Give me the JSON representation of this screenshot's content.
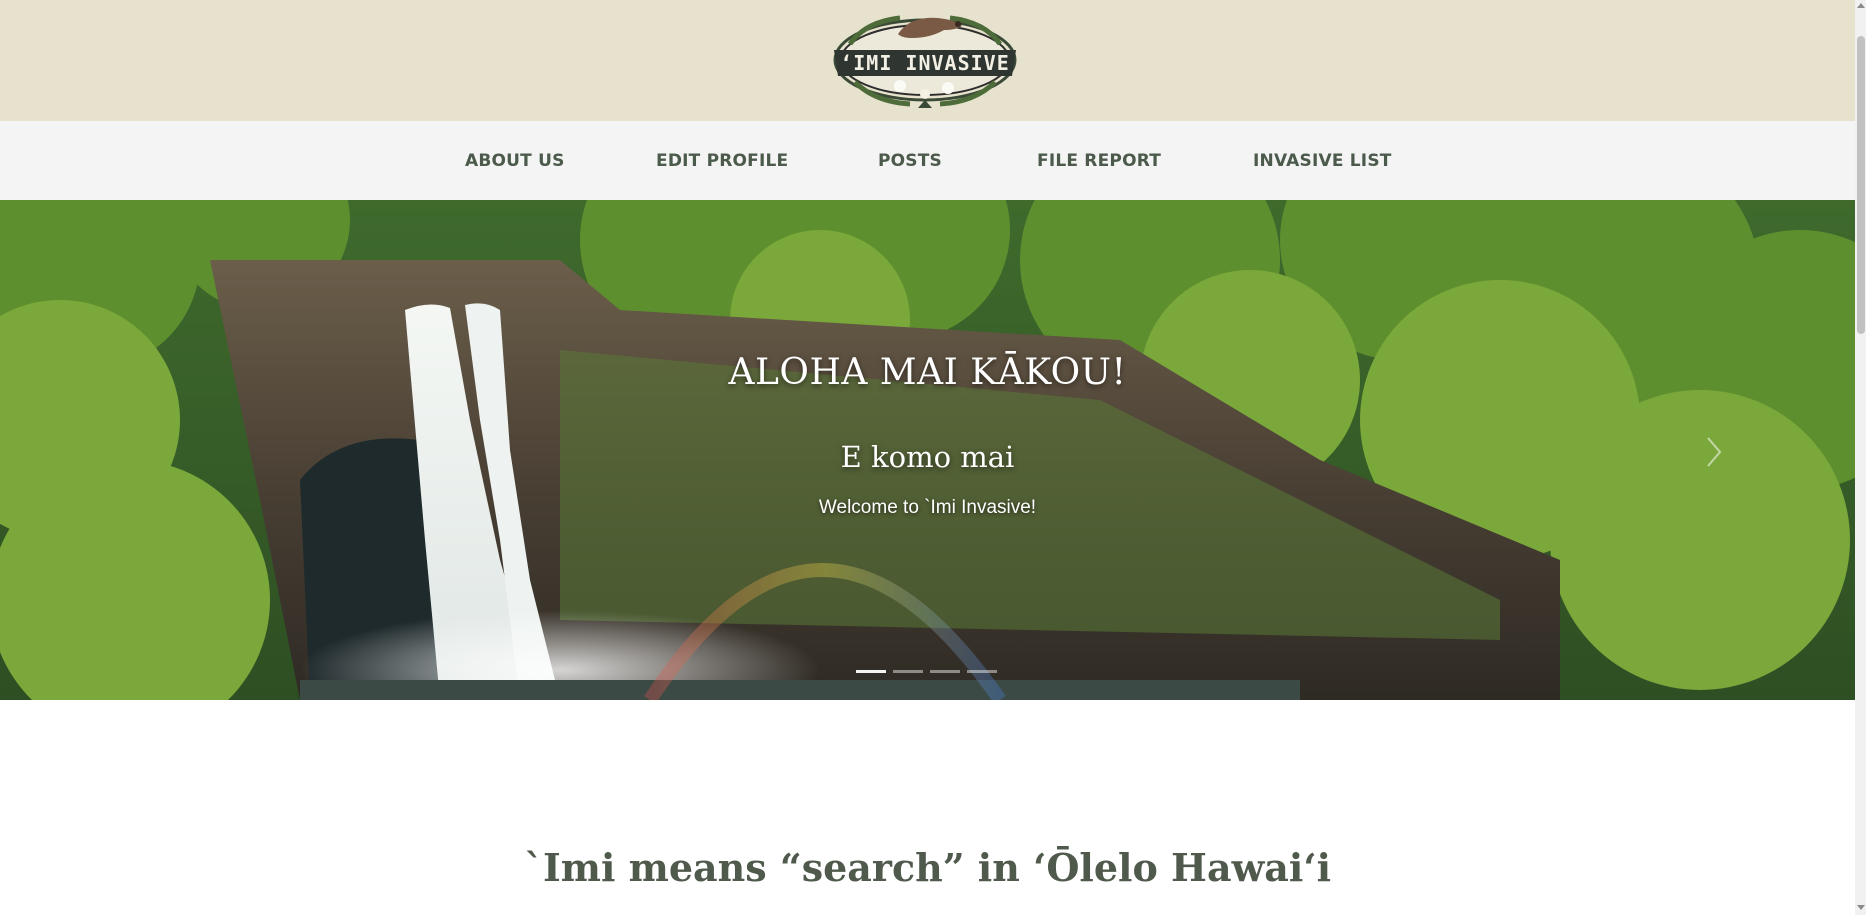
{
  "header": {
    "logo_text": "ʻIMI INVASIVE"
  },
  "nav": {
    "items": [
      {
        "label": "ABOUT US"
      },
      {
        "label": "EDIT PROFILE"
      },
      {
        "label": "POSTS"
      },
      {
        "label": "FILE REPORT"
      },
      {
        "label": "INVASIVE LIST"
      }
    ]
  },
  "hero": {
    "title": "ALOHA MAI KĀKOU!",
    "subtitle": "E komo mai",
    "caption": "Welcome to `Imi Invasive!",
    "next_icon": "chevron-right-icon",
    "slide_count": 4,
    "active_slide": 1
  },
  "intro": {
    "heading": "`Imi means “search” in ʻŌlelo Hawaiʻi"
  },
  "colors": {
    "header_bg": "#e6e2cd",
    "nav_bg": "#f4f4f4",
    "nav_text": "#4b5a4b",
    "heading_text": "#4f5a4c"
  }
}
